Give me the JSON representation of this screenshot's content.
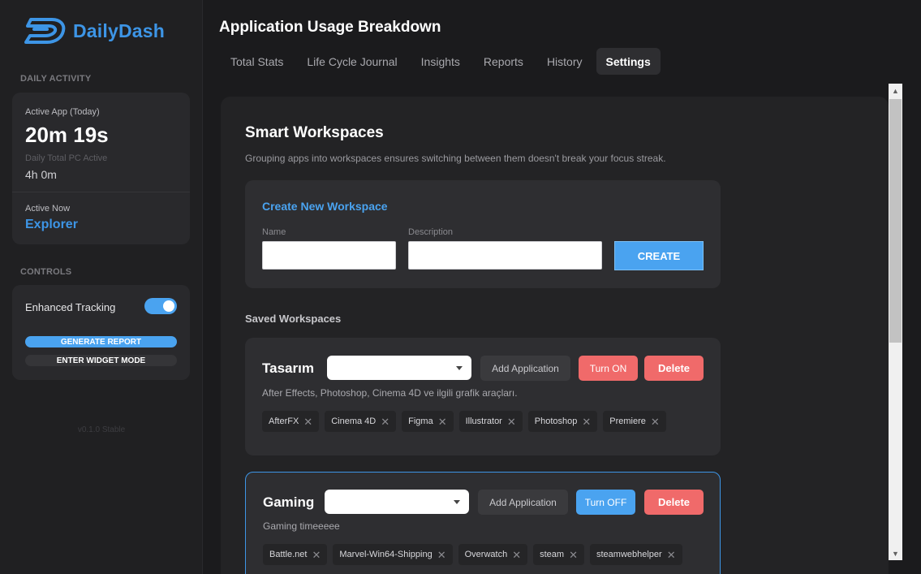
{
  "app": {
    "name": "DailyDash"
  },
  "sidebar": {
    "daily_activity_label": "DAILY ACTIVITY",
    "active_app_label": "Active App (Today)",
    "active_app_value": "20m 19s",
    "daily_total_label": "Daily Total PC Active",
    "daily_total_value": "4h 0m",
    "active_now_label": "Active Now",
    "active_now_value": "Explorer",
    "controls_label": "CONTROLS",
    "enhanced_tracking_label": "Enhanced Tracking",
    "enhanced_tracking_on": true,
    "generate_report_label": "GENERATE REPORT",
    "widget_mode_label": "ENTER WIDGET MODE",
    "version": "v0.1.0 Stable"
  },
  "header": {
    "title": "Application Usage Breakdown",
    "tabs": [
      {
        "label": "Total Stats",
        "active": false
      },
      {
        "label": "Life Cycle Journal",
        "active": false
      },
      {
        "label": "Insights",
        "active": false
      },
      {
        "label": "Reports",
        "active": false
      },
      {
        "label": "History",
        "active": false
      },
      {
        "label": "Settings",
        "active": true
      }
    ]
  },
  "workspaces": {
    "title": "Smart Workspaces",
    "description": "Grouping apps into workspaces ensures switching between them doesn't break your focus streak.",
    "create": {
      "title": "Create New Workspace",
      "name_label": "Name",
      "name_value": "",
      "description_label": "Description",
      "description_value": "",
      "create_label": "CREATE"
    },
    "saved_label": "Saved Workspaces",
    "items": [
      {
        "name": "Tasarım",
        "select_value": "",
        "add_label": "Add Application",
        "toggle_label": "Turn ON",
        "toggle_color": "#f06a6a",
        "delete_label": "Delete",
        "description": "After Effects, Photoshop, Cinema 4D ve ilgili grafik araçları.",
        "apps": [
          "AfterFX",
          "Cinema 4D",
          "Figma",
          "Illustrator",
          "Photoshop",
          "Premiere"
        ]
      },
      {
        "name": "Gaming",
        "select_value": "",
        "add_label": "Add Application",
        "toggle_label": "Turn OFF",
        "toggle_color": "#4aa3f0",
        "delete_label": "Delete",
        "description": "Gaming timeeeee",
        "apps": [
          "Battle.net",
          "Marvel-Win64-Shipping",
          "Overwatch",
          "steam",
          "steamwebhelper"
        ]
      }
    ]
  },
  "colors": {
    "accent": "#3d95e6",
    "danger": "#f06a6a",
    "panel": "#232325",
    "card": "#2e2e31"
  }
}
